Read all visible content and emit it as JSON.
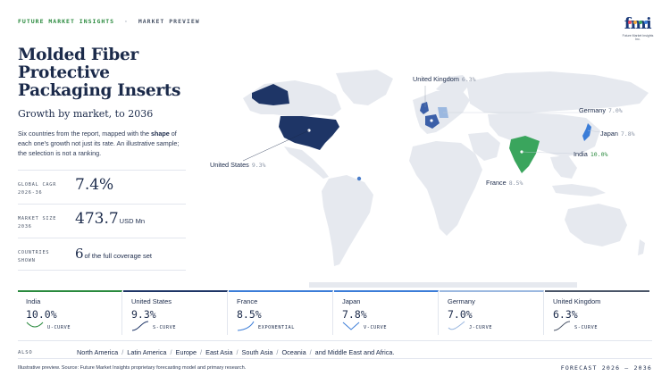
{
  "header": {
    "brand": "FUTURE MARKET INSIGHTS",
    "separator": "·",
    "section": "MARKET PREVIEW"
  },
  "logo": {
    "mark": "fmi",
    "tagline": "Future Market Insights Inc.",
    "dot_colors": [
      "#e84a5f",
      "#f2a93b",
      "#3aa55d",
      "#3b7dd8"
    ]
  },
  "report": {
    "title": "Molded Fiber Protective Packaging Inserts",
    "subtitle": "Growth by market, to 2036",
    "description_pre": "Six countries from the report, mapped with the ",
    "description_bold": "shape",
    "description_post": " of each one's growth not just its rate. An illustrative sample; the selection is not a ranking."
  },
  "stats": [
    {
      "label": "GLOBAL CAGR 2026-36",
      "value": "7.4%",
      "unit": ""
    },
    {
      "label": "MARKET SIZE 2036",
      "value": "473.7",
      "unit": "USD Mn"
    },
    {
      "label": "COUNTRIES SHOWN",
      "value": "6",
      "unit": "of the full coverage set"
    }
  ],
  "map": {
    "colors": {
      "land": "#e6e9ef",
      "usa": "#1e3566",
      "india": "#3aa55d",
      "europe": "#3b5fa8",
      "japan": "#3b7dd8",
      "highlight": "#4a7dc9"
    },
    "labels": [
      {
        "name": "United Kingdom",
        "value": "6.3%",
        "green": false
      },
      {
        "name": "Germany",
        "value": "7.0%",
        "green": false
      },
      {
        "name": "Japan",
        "value": "7.8%",
        "green": false
      },
      {
        "name": "India",
        "value": "10.0%",
        "green": true
      },
      {
        "name": "France",
        "value": "8.5%",
        "green": false
      },
      {
        "name": "United States",
        "value": "9.3%",
        "green": false
      }
    ]
  },
  "cards": [
    {
      "country": "India",
      "value": "10.0%",
      "curve": "U-CURVE",
      "color": "#2a8a3e"
    },
    {
      "country": "United States",
      "value": "9.3%",
      "curve": "S-CURVE",
      "color": "#1e3566"
    },
    {
      "country": "France",
      "value": "8.5%",
      "curve": "EXPONENTIAL",
      "color": "#3b7dd8"
    },
    {
      "country": "Japan",
      "value": "7.8%",
      "curve": "V-CURVE",
      "color": "#3b7dd8"
    },
    {
      "country": "Germany",
      "value": "7.0%",
      "curve": "J-CURVE",
      "color": "#9bb8e0"
    },
    {
      "country": "United Kingdom",
      "value": "6.3%",
      "curve": "S-CURVE",
      "color": "#4a5568"
    }
  ],
  "also": {
    "label": "ALSO",
    "regions": [
      "North America",
      "Latin America",
      "Europe",
      "East Asia",
      "South Asia",
      "Oceania",
      "and Middle East and Africa."
    ]
  },
  "footer": {
    "source": "Illustrative preview. Source: Future Market Insights proprietary forecasting model and primary research.",
    "forecast": "FORECAST 2026 – 2036"
  }
}
